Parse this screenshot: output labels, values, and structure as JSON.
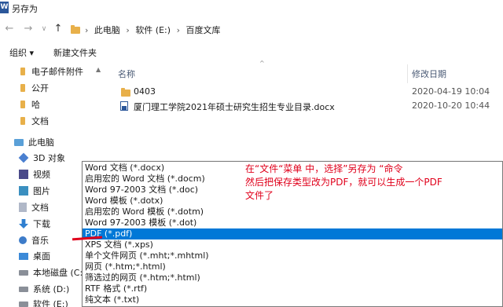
{
  "window": {
    "title": "另存为"
  },
  "address": {
    "crumbs": [
      "此电脑",
      "软件 (E:)",
      "百度文库"
    ]
  },
  "toolbar": {
    "organize": "组织 ▾",
    "new_folder": "新建文件夹"
  },
  "sidebar": {
    "quick": [
      "电子邮件附件",
      "公开",
      "哈",
      "文档"
    ],
    "this_pc": "此电脑",
    "pc_items": [
      "3D 对象",
      "视频",
      "图片",
      "文档",
      "下载",
      "音乐",
      "桌面",
      "本地磁盘 (C:)",
      "系统 (D:)",
      "软件 (E:)"
    ]
  },
  "list": {
    "col_name": "名称",
    "col_date": "修改日期",
    "rows": [
      {
        "name": "0403",
        "date": "2020-04-19 10:04",
        "kind": "folder"
      },
      {
        "name": "厦门理工学院2021年硕士研究生招生专业目录.docx",
        "date": "2020-10-20 10:44",
        "kind": "docx"
      }
    ]
  },
  "save_type_options": [
    "Word 文档 (*.docx)",
    "启用宏的 Word 文档 (*.docm)",
    "Word 97-2003 文档 (*.doc)",
    "Word 模板 (*.dotx)",
    "启用宏的 Word 模板 (*.dotm)",
    "Word 97-2003 模板 (*.dot)",
    "PDF (*.pdf)",
    "XPS 文档 (*.xps)",
    "单个文件网页 (*.mht;*.mhtml)",
    "网页 (*.htm;*.html)",
    "筛选过的网页 (*.htm;*.html)",
    "RTF 格式 (*.rtf)",
    "纯文本 (*.txt)"
  ],
  "selected_option": "PDF (*.pdf)",
  "annotation": {
    "line1": "在“文件“菜单 中，选择”另存为 “命令",
    "line2": "然后把保存类型改为PDF，就可以生成一个PDF",
    "line3": "文件了"
  },
  "colors": {
    "selection": "#0078d7",
    "annotation": "#e0001b",
    "folder": "#e8b04a"
  }
}
